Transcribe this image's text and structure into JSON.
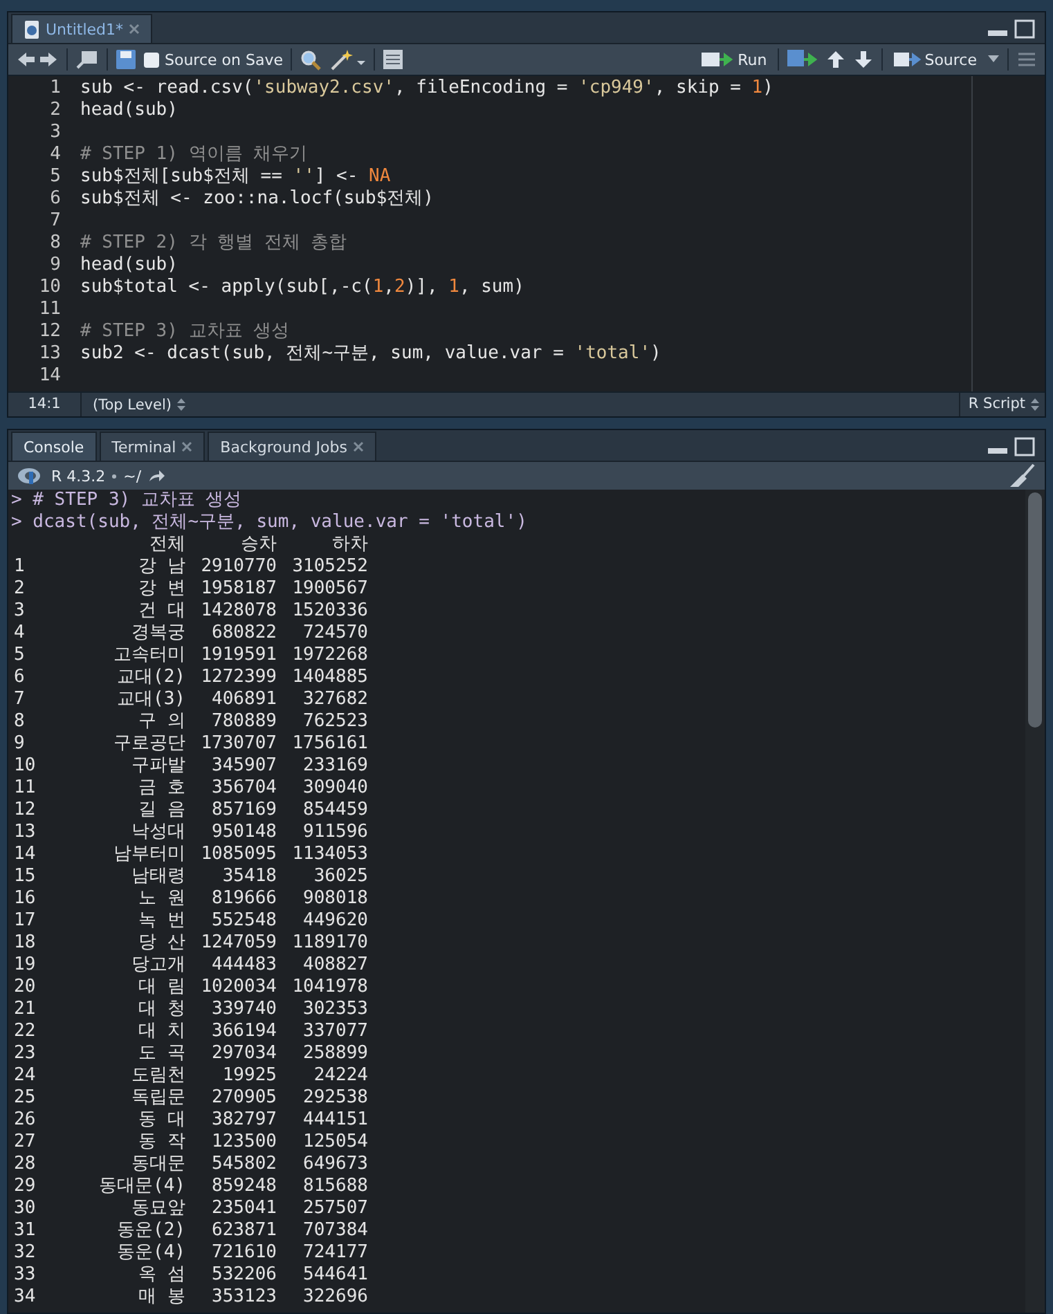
{
  "editor": {
    "tabs": [
      {
        "label": "Untitled1*",
        "selected": true,
        "closable": true
      }
    ],
    "toolbar": {
      "source_on_save": {
        "label": "Source on Save",
        "checked": false
      },
      "run": "Run",
      "source": "Source"
    },
    "lines": [
      {
        "number": "1",
        "segments": [
          {
            "text": "sub <- read.csv(",
            "kind": "code"
          },
          {
            "text": "'subway2.csv'",
            "kind": "string"
          },
          {
            "text": ", fileEncoding = ",
            "kind": "code"
          },
          {
            "text": "'cp949'",
            "kind": "string"
          },
          {
            "text": ", skip = ",
            "kind": "code"
          },
          {
            "text": "1",
            "kind": "number"
          },
          {
            "text": ")",
            "kind": "code"
          }
        ]
      },
      {
        "number": "2",
        "segments": [
          {
            "text": "head(sub)",
            "kind": "code"
          }
        ]
      },
      {
        "number": "3"
      },
      {
        "number": "4",
        "segments": [
          {
            "text": "# STEP 1) 역이름 채우기",
            "kind": "comment"
          }
        ]
      },
      {
        "number": "5",
        "segments": [
          {
            "text": "sub$전체[sub$전체 == ",
            "kind": "code"
          },
          {
            "text": "''",
            "kind": "string"
          },
          {
            "text": "] <- ",
            "kind": "code"
          },
          {
            "text": "NA",
            "kind": "number"
          }
        ]
      },
      {
        "number": "6",
        "segments": [
          {
            "text": "sub$전체 <- zoo::na.locf(sub$전체)",
            "kind": "code"
          }
        ]
      },
      {
        "number": "7"
      },
      {
        "number": "8",
        "segments": [
          {
            "text": "# STEP 2) 각 행별 전체 총합",
            "kind": "comment"
          }
        ]
      },
      {
        "number": "9",
        "segments": [
          {
            "text": "head(sub)",
            "kind": "code"
          }
        ]
      },
      {
        "number": "10",
        "segments": [
          {
            "text": "sub$total <- apply(sub[,-c(",
            "kind": "code"
          },
          {
            "text": "1",
            "kind": "number"
          },
          {
            "text": ",",
            "kind": "code"
          },
          {
            "text": "2",
            "kind": "number"
          },
          {
            "text": ")], ",
            "kind": "code"
          },
          {
            "text": "1",
            "kind": "number"
          },
          {
            "text": ", sum)",
            "kind": "code"
          }
        ]
      },
      {
        "number": "11"
      },
      {
        "number": "12",
        "segments": [
          {
            "text": "# STEP 3) 교차표 생성",
            "kind": "comment"
          }
        ]
      },
      {
        "number": "13",
        "segments": [
          {
            "text": "sub2 <- dcast(sub, 전체~구분, sum, value.var = ",
            "kind": "code"
          },
          {
            "text": "'total'",
            "kind": "string"
          },
          {
            "text": ")",
            "kind": "code"
          }
        ]
      },
      {
        "number": "14"
      }
    ],
    "status_bar": {
      "position": "14:1",
      "scope": "(Top Level)",
      "file_type": "R Script"
    }
  },
  "console": {
    "tabs": [
      {
        "label": "Console",
        "selected": true,
        "closable": false
      },
      {
        "label": "Terminal",
        "selected": false,
        "closable": true
      },
      {
        "label": "Background Jobs",
        "selected": false,
        "closable": true
      }
    ],
    "r_version": "R 4.3.2",
    "path": "~/",
    "commands": [
      "> # STEP 3) 교차표 생성",
      "> dcast(sub, 전체~구분, sum, value.var = 'total')"
    ],
    "table": {
      "columns": [
        "",
        "전체",
        "승차",
        "하차"
      ],
      "rows": [
        [
          "1",
          "강 남",
          "2910770",
          "3105252"
        ],
        [
          "2",
          "강 변",
          "1958187",
          "1900567"
        ],
        [
          "3",
          "건 대",
          "1428078",
          "1520336"
        ],
        [
          "4",
          "경복궁",
          "680822",
          "724570"
        ],
        [
          "5",
          "고속터미",
          "1919591",
          "1972268"
        ],
        [
          "6",
          "교대(2)",
          "1272399",
          "1404885"
        ],
        [
          "7",
          "교대(3)",
          "406891",
          "327682"
        ],
        [
          "8",
          "구 의",
          "780889",
          "762523"
        ],
        [
          "9",
          "구로공단",
          "1730707",
          "1756161"
        ],
        [
          "10",
          "구파발",
          "345907",
          "233169"
        ],
        [
          "11",
          "금 호",
          "356704",
          "309040"
        ],
        [
          "12",
          "길 음",
          "857169",
          "854459"
        ],
        [
          "13",
          "낙성대",
          "950148",
          "911596"
        ],
        [
          "14",
          "남부터미",
          "1085095",
          "1134053"
        ],
        [
          "15",
          "남태령",
          "35418",
          "36025"
        ],
        [
          "16",
          "노 원",
          "819666",
          "908018"
        ],
        [
          "17",
          "녹 번",
          "552548",
          "449620"
        ],
        [
          "18",
          "당 산",
          "1247059",
          "1189170"
        ],
        [
          "19",
          "당고개",
          "444483",
          "408827"
        ],
        [
          "20",
          "대 림",
          "1020034",
          "1041978"
        ],
        [
          "21",
          "대 청",
          "339740",
          "302353"
        ],
        [
          "22",
          "대 치",
          "366194",
          "337077"
        ],
        [
          "23",
          "도 곡",
          "297034",
          "258899"
        ],
        [
          "24",
          "도림천",
          "19925",
          "24224"
        ],
        [
          "25",
          "독립문",
          "270905",
          "292538"
        ],
        [
          "26",
          "동 대",
          "382797",
          "444151"
        ],
        [
          "27",
          "동 작",
          "123500",
          "125054"
        ],
        [
          "28",
          "동대문",
          "545802",
          "649673"
        ],
        [
          "29",
          "동대문(4)",
          "859248",
          "815688"
        ],
        [
          "30",
          "동묘앞",
          "235041",
          "257507"
        ],
        [
          "31",
          "동운(2)",
          "623871",
          "707384"
        ],
        [
          "32",
          "동운(4)",
          "721610",
          "724177"
        ],
        [
          "33",
          "옥 섬",
          "532206",
          "544641"
        ],
        [
          "34",
          "매 봉",
          "353123",
          "322696"
        ]
      ]
    }
  }
}
